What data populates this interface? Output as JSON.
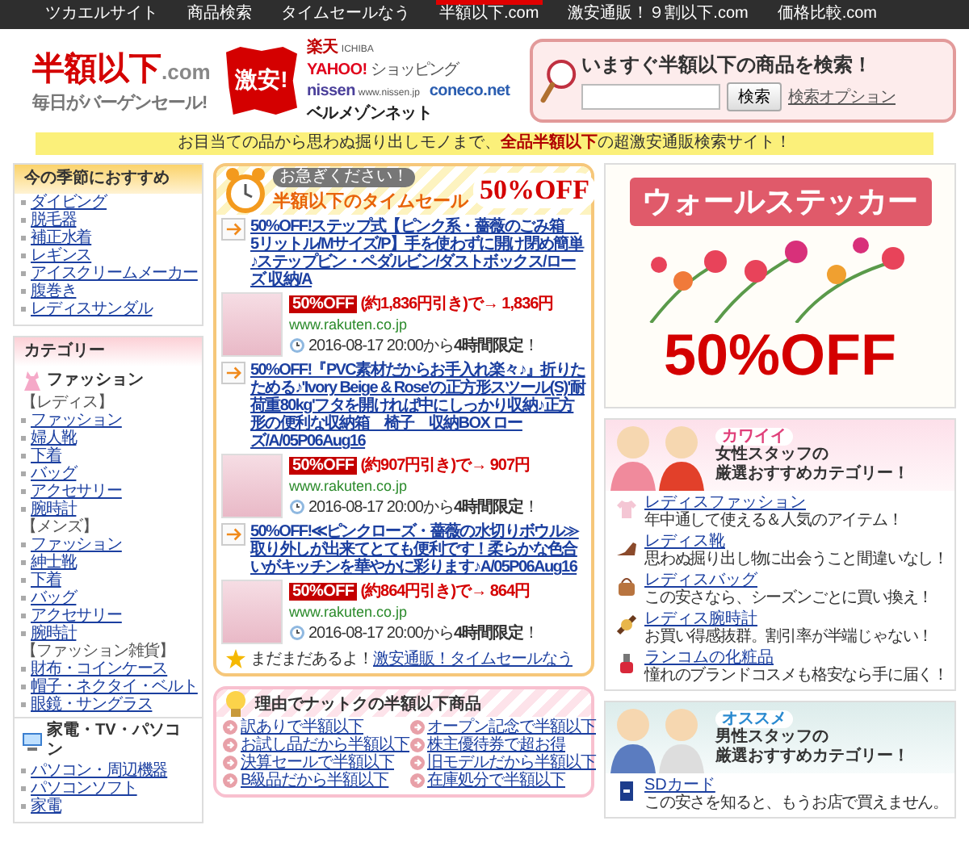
{
  "nav": {
    "items": [
      {
        "label": "ツカエルサイト",
        "selected": false
      },
      {
        "label": "商品検索",
        "selected": false
      },
      {
        "label": "タイムセールなう",
        "selected": false
      },
      {
        "label": "半額以下.com",
        "selected": true
      },
      {
        "label": "激安通販！９割以下.com",
        "selected": false
      },
      {
        "label": "価格比較.com",
        "selected": false
      }
    ]
  },
  "header": {
    "logo": {
      "title": "半額以下",
      "suffix": ".com",
      "tagline": "毎日がバーゲンセール!"
    },
    "badge": "激安!",
    "partners": [
      {
        "name": "楽天",
        "sub": "ICHIBA",
        "color": "#bf0000"
      },
      {
        "name": "YAHOO!",
        "sub": "ショッピング",
        "color": "#e0001b"
      },
      {
        "name": "nissen",
        "sub": "www.nissen.jp",
        "color": "#4a3f9a"
      },
      {
        "name": "coneco.net",
        "color": "#2a5db0"
      },
      {
        "name": "ベルメゾンネット",
        "color": "#222222"
      }
    ],
    "search": {
      "title": "いますぐ半額以下の商品を検索！",
      "button": "検索",
      "option": "検索オプション"
    }
  },
  "banner": "お目当ての品から思わぬ掘り出しモノまで、**全品半額以下**の超激安通販検索サイト！",
  "sidebar": {
    "season": {
      "title": "今の季節におすすめ",
      "items": [
        "ダイビング",
        "脱毛器",
        "補正水着",
        "レギンス",
        "アイスクリームメーカー",
        "腹巻き",
        "レディスサンダル"
      ]
    },
    "categories": {
      "title": "カテゴリー",
      "groups": [
        {
          "name": "ファッション",
          "sections": [
            {
              "label": "【レディス】",
              "items": [
                "ファッション",
                "婦人靴",
                "下着",
                "バッグ",
                "アクセサリー",
                "腕時計"
              ]
            },
            {
              "label": "【メンズ】",
              "items": [
                "ファッション",
                "紳士靴",
                "下着",
                "バッグ",
                "アクセサリー",
                "腕時計"
              ]
            },
            {
              "label": "【ファッション雑貨】",
              "items": [
                "財布・コインケース",
                "帽子・ネクタイ・ベルト",
                "眼鏡・サングラス"
              ]
            }
          ]
        },
        {
          "name": "家電・TV・パソコン",
          "sections": [
            {
              "items": [
                "パソコン・周辺機器",
                "パソコンソフト",
                "家電"
              ]
            }
          ]
        }
      ]
    }
  },
  "time_sale": {
    "note": "お急ぎください！",
    "title": "半額以下のタイムセール",
    "discount": "50%OFF",
    "items": [
      {
        "title": "50%OFF!ステップ式【ピンク系・薔薇のごみ箱　5リットル/Mサイズ/P】手を使わずに開け閉め簡単♪ステップビン・ペダルビン/ダストボックス/ローズ 収納/A",
        "discount": "50%OFF",
        "price": "(約1,836円引き)で→ 1,836円",
        "source": "www.rakuten.co.jp",
        "time": "2016-08-17 20:00から**4時間限定**！"
      },
      {
        "title": "50%OFF!『PVC素材だからお手入れ楽々♪』折りたためる♪'Ivory Beige & Rose'の正方形スツール(S)'耐荷重80kg'フタを開ければ中にしっかり収納♪正方形の便利な収納箱　椅子　収納BOX ローズ/A/05P06Aug16",
        "discount": "50%OFF",
        "price": "(約907円引き)で→ 907円",
        "source": "www.rakuten.co.jp",
        "time": "2016-08-17 20:00から**4時間限定**！"
      },
      {
        "title": "50%OFF!≪ピンクローズ・薔薇の水切りボウル≫取り外しが出来てとても便利です！柔らかな色合いがキッチンを華やかに彩ります♪A/05P06Aug16",
        "discount": "50%OFF",
        "price": "(約864円引き)で→ 864円",
        "source": "www.rakuten.co.jp",
        "time": "2016-08-17 20:00から**4時間限定**！"
      }
    ],
    "more": "まだまだあるよ！",
    "more_link": "激安通販！タイムセールなう"
  },
  "reasons": {
    "title": "理由でナットクの半額以下商品",
    "items": [
      "訳ありで半額以下",
      "オープン記念で半額以下",
      "お試し品だから半額以下",
      "株主優待券で超お得",
      "決算セールで半額以下",
      "旧モデルだから半額以下",
      "B級品だから半額以下",
      "在庫処分で半額以下"
    ]
  },
  "ad": {
    "title": "ウォールステッカー",
    "discount": "50%OFF"
  },
  "staff": [
    {
      "kind": "female",
      "tag": "カワイイ",
      "title_lines": [
        "女性スタッフの",
        "厳選おすすめカテゴリー！"
      ],
      "items": [
        {
          "name": "レディスファッション",
          "desc": "年中通して使える＆人気のアイテム！"
        },
        {
          "name": "レディス靴",
          "desc": "思わぬ掘り出し物に出会うこと間違いなし！"
        },
        {
          "name": "レディスバッグ",
          "desc": "この安さなら、シーズンごとに買い換え！"
        },
        {
          "name": "レディス腕時計",
          "desc": "お買い得感抜群。割引率が半端じゃない！"
        },
        {
          "name": "ランコムの化粧品",
          "desc": "憧れのブランドコスメも格安なら手に届く！"
        }
      ]
    },
    {
      "kind": "male",
      "tag": "オススメ",
      "title_lines": [
        "男性スタッフの",
        "厳選おすすめカテゴリー！"
      ],
      "items": [
        {
          "name": "SDカード",
          "desc": "この安さを知ると、もうお店で買えません。"
        }
      ]
    }
  ]
}
